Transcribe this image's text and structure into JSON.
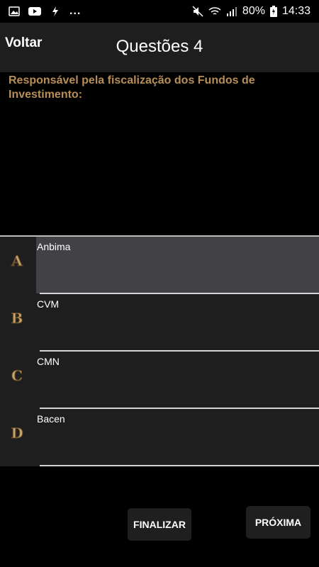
{
  "status_bar": {
    "battery": "80%",
    "time": "14:33",
    "dots": "...",
    "icons": [
      "image-icon",
      "youtube-icon",
      "flash-icon",
      "mute-icon",
      "wifi-icon",
      "signal-icon",
      "battery-icon"
    ]
  },
  "header": {
    "back_label": "Voltar",
    "title": "Questões 4"
  },
  "question": {
    "text": "Responsável pela fiscalização dos Fundos de Investimento:"
  },
  "options": [
    {
      "letter": "A",
      "text": "Anbima",
      "selected": true
    },
    {
      "letter": "B",
      "text": "CVM",
      "selected": false
    },
    {
      "letter": "C",
      "text": "CMN",
      "selected": false
    },
    {
      "letter": "D",
      "text": "Bacen",
      "selected": false
    }
  ],
  "buttons": {
    "finalize": "FINALIZAR",
    "next": "PRÓXIMA"
  },
  "colors": {
    "question_text": "#b88e57",
    "header_bg": "#1e1e1e",
    "selected_bg": "#414146",
    "letter_gold": "#c9a36a"
  }
}
